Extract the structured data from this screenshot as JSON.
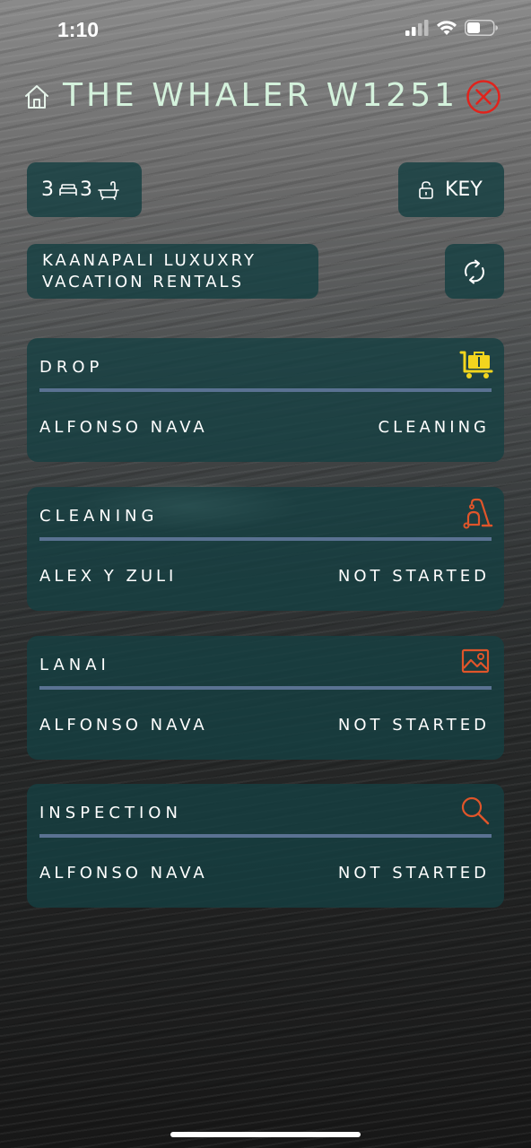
{
  "status_bar": {
    "time": "1:10"
  },
  "header": {
    "title": "THE WHALER W1251",
    "home_icon": "home-icon",
    "close_icon": "close-circle-icon",
    "close_color": "#e0231c",
    "title_color": "#d4f2dc"
  },
  "unit_info": {
    "bedrooms": "3",
    "bathrooms": "3",
    "key_label": "KEY",
    "company": "KAANAPALI LUXUXRY\nVACATION RENTALS"
  },
  "tasks": [
    {
      "title": "DROP",
      "person": "ALFONSO NAVA",
      "status": "CLEANING",
      "icon": "luggage-cart-icon",
      "icon_color": "#f2d51e"
    },
    {
      "title": "CLEANING",
      "person": "ALEX Y ZULI",
      "status": "NOT STARTED",
      "icon": "vacuum-icon",
      "icon_color": "#e0552a"
    },
    {
      "title": "LANAI",
      "person": "ALFONSO NAVA",
      "status": "NOT STARTED",
      "icon": "image-icon",
      "icon_color": "#e0552a"
    },
    {
      "title": "INSPECTION",
      "person": "ALFONSO NAVA",
      "status": "NOT STARTED",
      "icon": "search-icon",
      "icon_color": "#e0552a"
    }
  ],
  "colors": {
    "card_bg": "#154042",
    "divider": "#5a7292"
  }
}
